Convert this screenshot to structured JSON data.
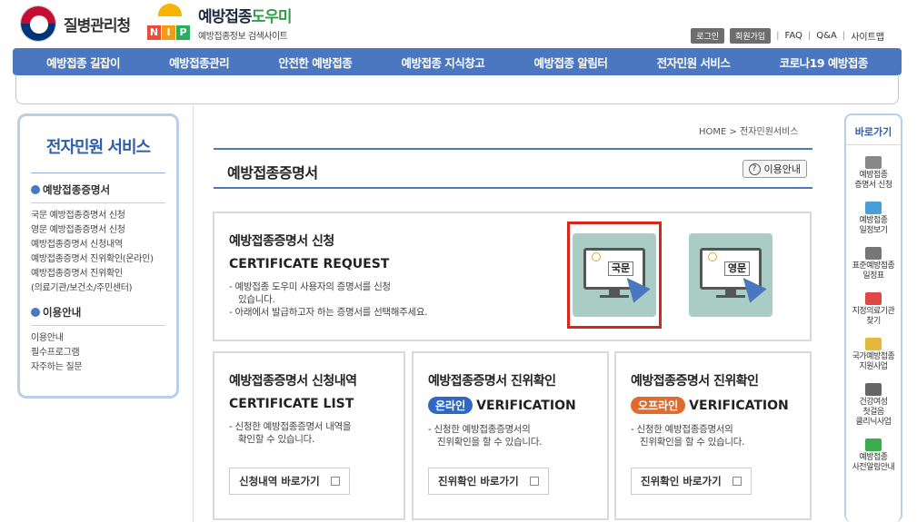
{
  "header": {
    "kdca_name": "질병관리청",
    "nip_title_a": "예방접종",
    "nip_title_b": "도우미",
    "nip_subtitle": "예방접종정보 검색사이트",
    "nip_letters": [
      "N",
      "I",
      "P"
    ],
    "util": {
      "login": "로그인",
      "join": "회원가입",
      "faq": "FAQ",
      "qa": "Q&A",
      "sitemap": "사이트맵"
    }
  },
  "gnb": [
    "예방접종 길잡이",
    "예방접종관리",
    "안전한 예방접종",
    "예방접종 지식창고",
    "예방접종 알림터",
    "전자민원 서비스",
    "코로나19 예방접종"
  ],
  "lnb": {
    "title": "전자민원 서비스",
    "cat1": "예방접종증명서",
    "cat1_items": [
      "국문 예방접종증명서 신청",
      "영문 예방접종증명서 신청",
      "예방접종증명서 신청내역",
      "예방접종증명서 진위확인(온라인)",
      "예방접종증명서 진위확인",
      "(의료기관/보건소/주민센터)"
    ],
    "cat2": "이용안내",
    "cat2_items": [
      "이용안내",
      "필수프로그램",
      "자주하는 질문"
    ]
  },
  "breadcrumb": {
    "home": "HOME",
    "sep": ">",
    "current": "전자민원서비스"
  },
  "page": {
    "title": "예방접종증명서",
    "guide": "이용안내",
    "guide_q": "?"
  },
  "request": {
    "title": "예방접종증명서 신청",
    "en": "CERTIFICATE REQUEST",
    "desc1": "- 예방접종 도우미 사용자의 증명서를 신청",
    "desc2": "  있습니다.",
    "desc3": "- 아래에서 발급하고자 하는 증명서를 선택해주세요.",
    "korean_label": "국문",
    "english_label": "영문"
  },
  "list_box": {
    "title": "예방접종증명서 신청내역",
    "en": "CERTIFICATE LIST",
    "desc1": "- 신청한 예방접종증명서 내역을",
    "desc2": "  확인할 수 있습니다.",
    "link": "신청내역 바로가기"
  },
  "verify_online": {
    "title": "예방접종증명서 진위확인",
    "pill": "온라인",
    "en": "VERIFICATION",
    "desc1": "- 신청한 예방접종증명서의",
    "desc2": "  진위확인을 할 수 있습니다.",
    "link": "진위확인 바로가기"
  },
  "verify_offline": {
    "title": "예방접종증명서 진위확인",
    "pill": "오프라인",
    "en": "VERIFICATION",
    "desc1": "- 신청한 예방접종증명서의",
    "desc2": "  진위확인을 할 수 있습니다.",
    "link": "진위확인 바로가기"
  },
  "quick": {
    "title": "바로가기",
    "items": [
      [
        "예방접종",
        "증명서 신청"
      ],
      [
        "예방접종",
        "일정보기"
      ],
      [
        "표준예방접종",
        "일정표"
      ],
      [
        "지정의료기관",
        "찾기"
      ],
      [
        "국가예방접종",
        "지원사업"
      ],
      [
        "건강여성",
        "첫걸음",
        "클리닉사업"
      ],
      [
        "예방접종",
        "사전알림안내"
      ]
    ],
    "icons": [
      "printer-icon",
      "calendar-icon",
      "syringe-icon",
      "hospital-icon",
      "document-icon",
      "box-icon",
      "speaker-icon"
    ]
  },
  "colors": {
    "primary": "#4a77c0",
    "highlight": "#d9261c",
    "card": "#a9cdc5",
    "online": "#2f68c4",
    "offline": "#e26a2c"
  }
}
